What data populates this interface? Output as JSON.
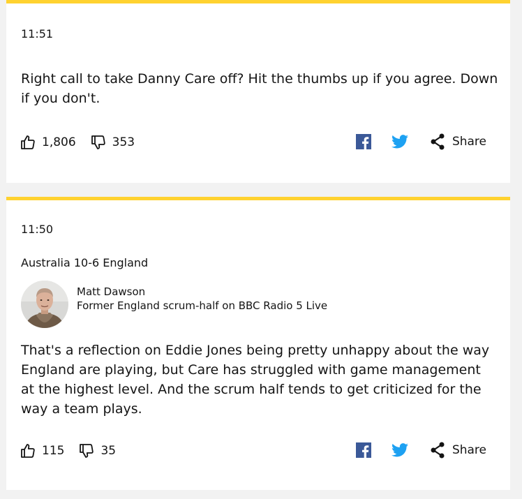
{
  "posts": [
    {
      "time": "11:51",
      "text": "Right call to take Danny Care off? Hit the thumbs up if you agree. Down if you don't.",
      "likes": "1,806",
      "dislikes": "353",
      "share_label": "Share"
    },
    {
      "time": "11:50",
      "headline": "Australia 10-6 England",
      "contributor": {
        "name": "Matt Dawson",
        "role": "Former England scrum-half on BBC Radio 5 Live"
      },
      "text": "That's a reflection on Eddie Jones being pretty unhappy about the way England are playing, but Care has struggled with game management at the highest level. And the scrum half tends to get criticized for the way a team plays.",
      "likes": "115",
      "dislikes": "35",
      "share_label": "Share"
    }
  ],
  "icons": {
    "like": "thumbs-up-icon",
    "dislike": "thumbs-down-icon",
    "facebook": "facebook-icon",
    "twitter": "twitter-icon",
    "share": "share-icon"
  },
  "colors": {
    "accent_bar": "#ffd230",
    "facebook": "#3b5998",
    "twitter": "#1da1f2",
    "background": "#f2f2f2",
    "card": "#ffffff"
  }
}
